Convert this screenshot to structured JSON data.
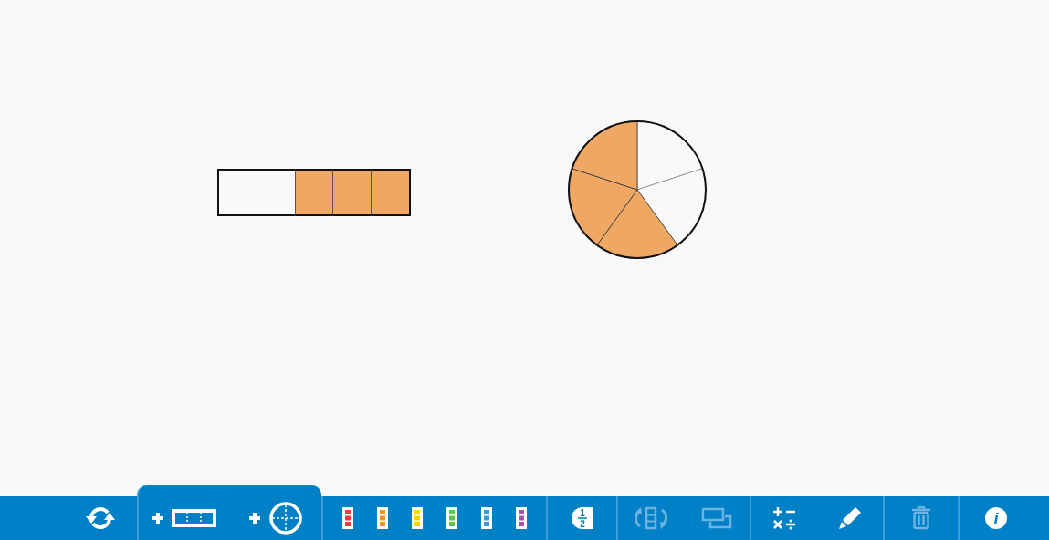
{
  "shapes": [
    {
      "kind": "bar",
      "pieces": [
        {
          "filled": false
        },
        {
          "filled": false
        },
        {
          "filled": true
        },
        {
          "filled": true
        },
        {
          "filled": true
        }
      ]
    },
    {
      "kind": "pie",
      "pieces": [
        {
          "filled": false
        },
        {
          "filled": false
        },
        {
          "filled": true
        },
        {
          "filled": true
        },
        {
          "filled": true
        }
      ]
    }
  ],
  "toolbar": {
    "groups": [
      {
        "selected": false,
        "items": [
          {
            "kind": "refresh",
            "disabled": false
          }
        ]
      },
      {
        "selected": true,
        "items": [
          {
            "kind": "add-bar",
            "disabled": false
          },
          {
            "kind": "add-circle",
            "disabled": false
          }
        ]
      },
      {
        "selected": false,
        "items": [
          {
            "kind": "swatch",
            "color": "#e8413b"
          },
          {
            "kind": "swatch",
            "color": "#f7941d"
          },
          {
            "kind": "swatch",
            "color": "#f5d800"
          },
          {
            "kind": "swatch",
            "color": "#5bc84a"
          },
          {
            "kind": "swatch",
            "color": "#3a9ad9"
          },
          {
            "kind": "swatch",
            "color": "#a94fb0"
          }
        ]
      },
      {
        "selected": false,
        "items": [
          {
            "kind": "fraction-label",
            "numerator": "1",
            "denominator": "2",
            "disabled": false
          }
        ]
      },
      {
        "selected": false,
        "items": [
          {
            "kind": "rotate",
            "disabled": true
          },
          {
            "kind": "resize",
            "disabled": true
          }
        ]
      },
      {
        "selected": false,
        "items": [
          {
            "kind": "operations",
            "disabled": false
          },
          {
            "kind": "pencil",
            "disabled": false
          }
        ]
      },
      {
        "selected": false,
        "items": [
          {
            "kind": "trash",
            "disabled": true
          }
        ]
      },
      {
        "selected": false,
        "items": [
          {
            "kind": "info",
            "glyph": "i",
            "disabled": false
          }
        ]
      }
    ]
  }
}
